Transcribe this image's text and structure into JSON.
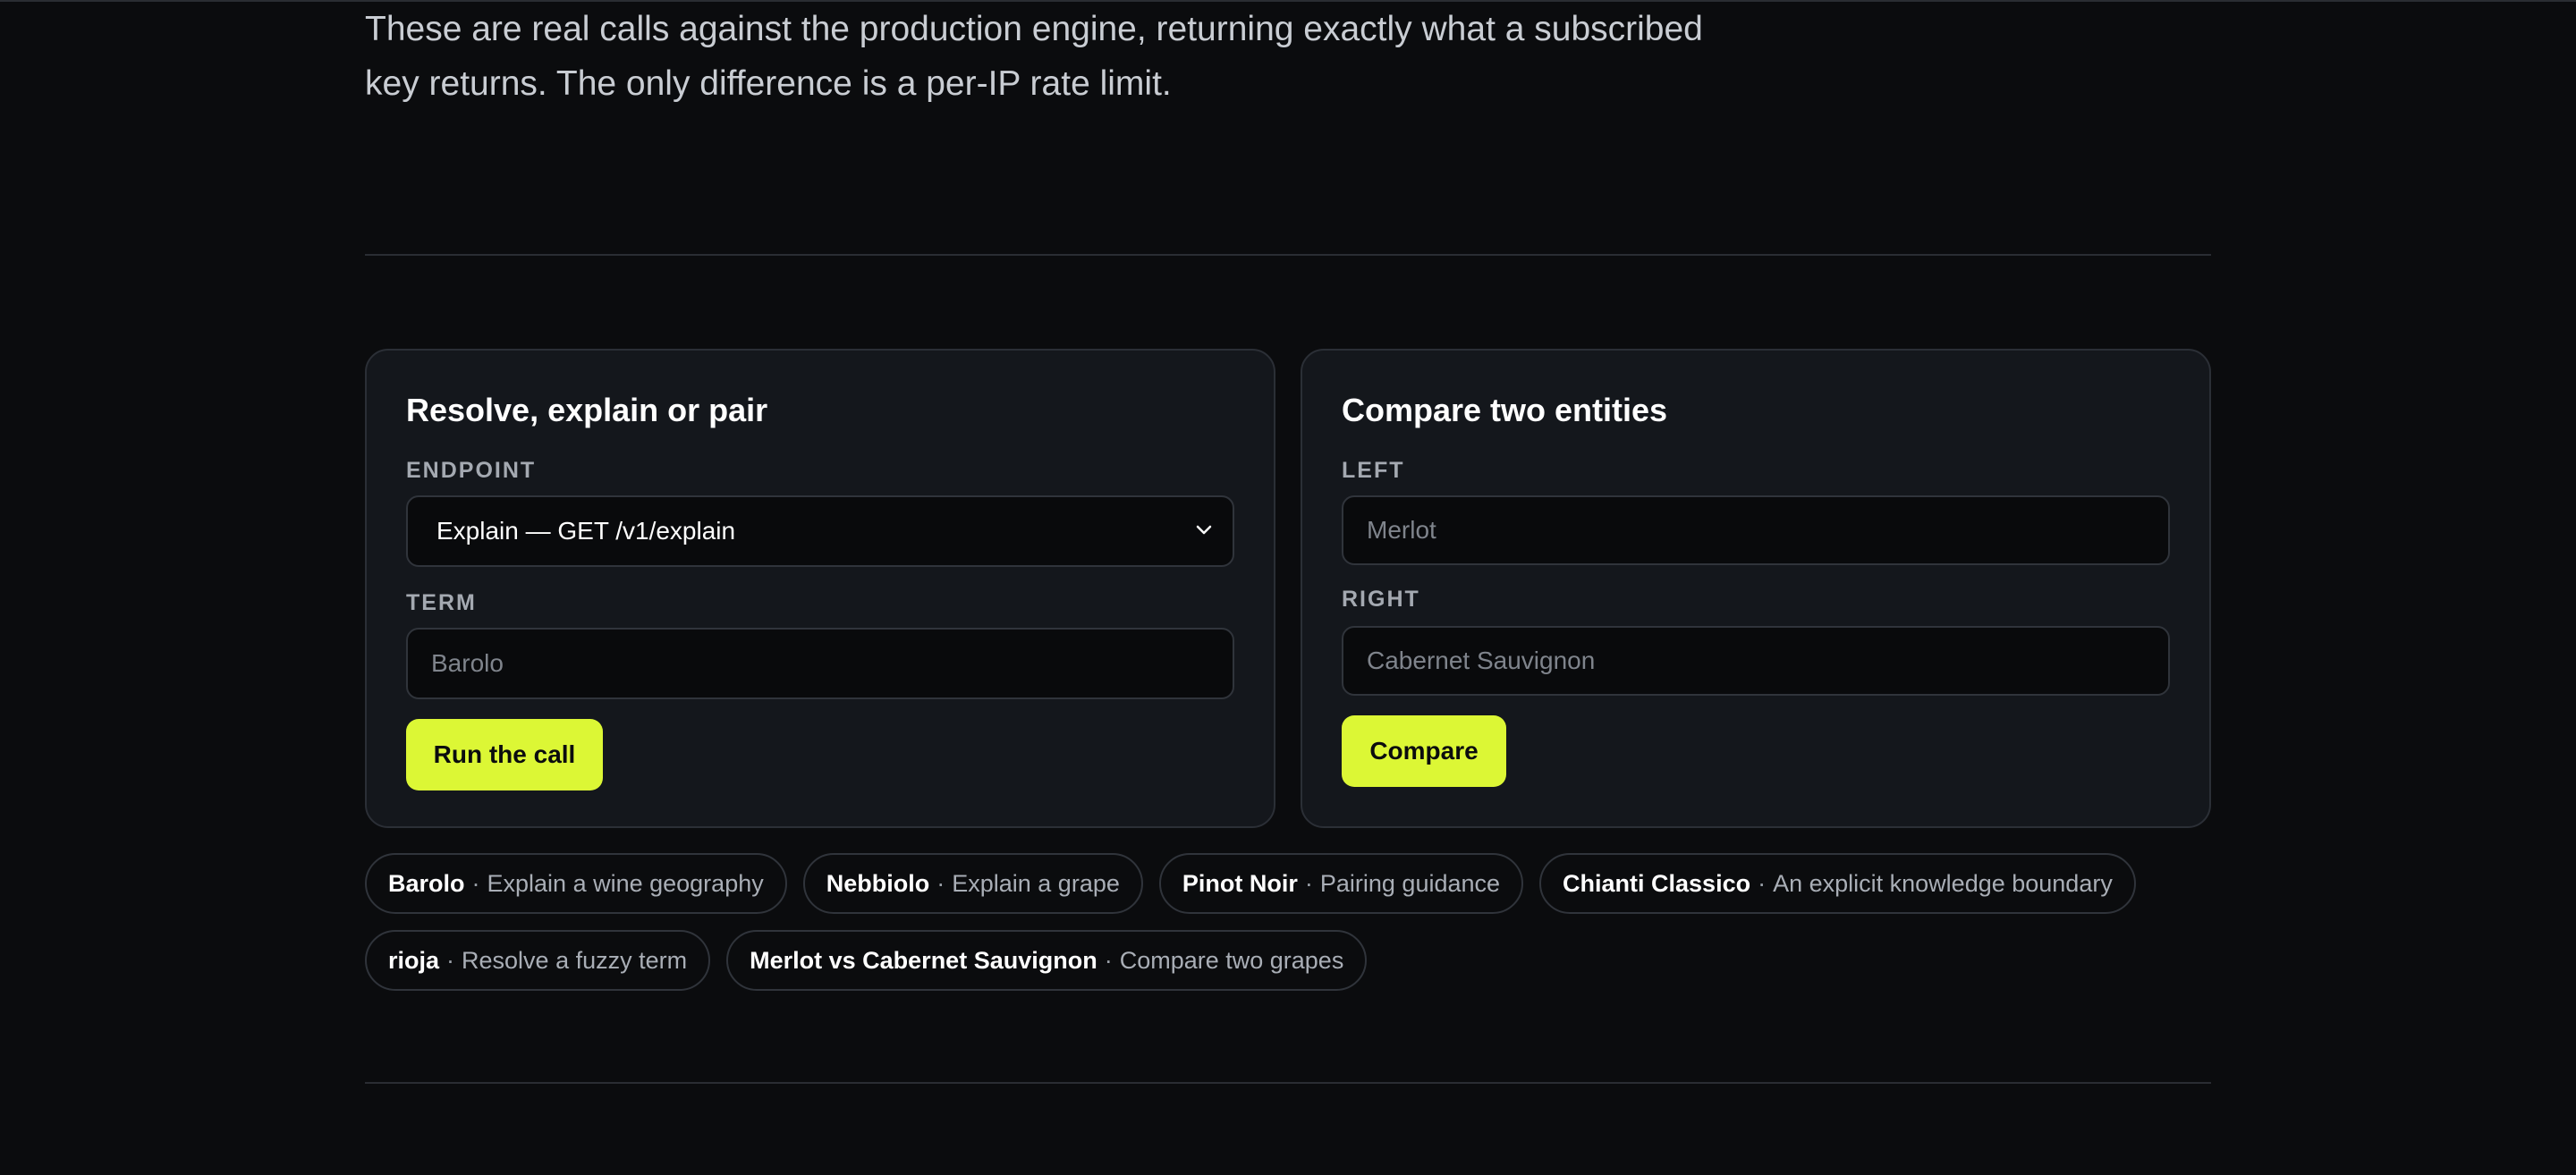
{
  "intro": {
    "line1": "These are real calls against the production engine, returning exactly what a subscribed",
    "line2": "key returns. The only difference is a per-IP rate limit."
  },
  "left_card": {
    "title": "Resolve, explain or pair",
    "endpoint_label": "ENDPOINT",
    "endpoint_value": "Explain — GET /v1/explain",
    "term_label": "TERM",
    "term_placeholder": "Barolo",
    "button_label": "Run the call"
  },
  "right_card": {
    "title": "Compare two entities",
    "left_label": "LEFT",
    "left_placeholder": "Merlot",
    "right_label": "RIGHT",
    "right_placeholder": "Cabernet Sauvignon",
    "button_label": "Compare"
  },
  "chips": [
    {
      "name": "Barolo",
      "sep": "·",
      "desc": "Explain a wine geography"
    },
    {
      "name": "Nebbiolo",
      "sep": "·",
      "desc": "Explain a grape"
    },
    {
      "name": "Pinot Noir",
      "sep": "·",
      "desc": "Pairing guidance"
    },
    {
      "name": "Chianti Classico",
      "sep": "·",
      "desc": "An explicit knowledge boundary"
    },
    {
      "name": "rioja",
      "sep": "·",
      "desc": "Resolve a fuzzy term"
    },
    {
      "name": "Merlot vs Cabernet Sauvignon",
      "sep": "·",
      "desc": "Compare two grapes"
    }
  ],
  "colors": {
    "accent": "#dcf735",
    "background": "#0b0c0e",
    "card": "#14171c"
  }
}
